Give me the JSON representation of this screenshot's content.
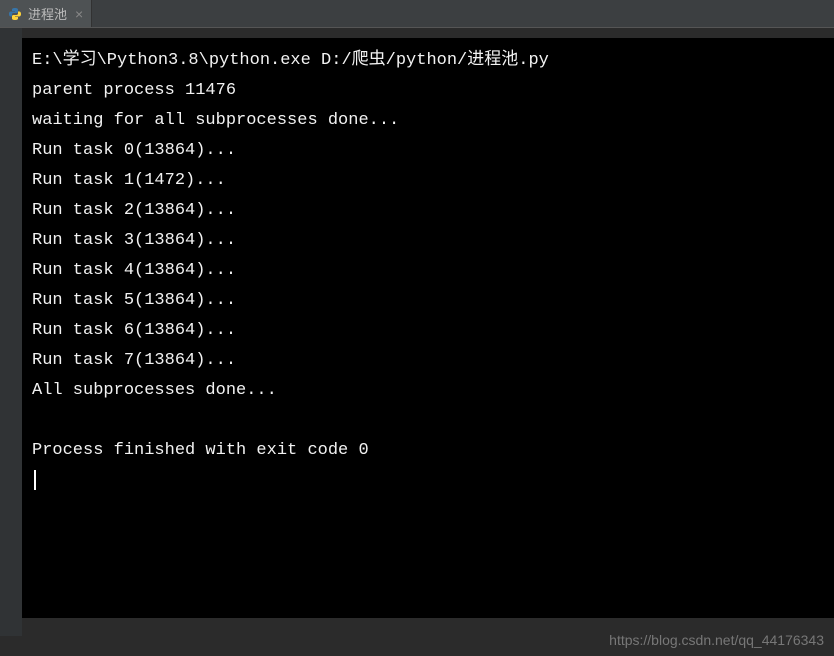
{
  "tab": {
    "label": "进程池",
    "close_symbol": "×"
  },
  "console": {
    "command": "E:\\学习\\Python3.8\\python.exe D:/爬虫/python/进程池.py",
    "lines": [
      "parent process 11476",
      "waiting for all subprocesses done...",
      "Run task 0(13864)...",
      "Run task 1(1472)...",
      "Run task 2(13864)...",
      "Run task 3(13864)...",
      "Run task 4(13864)...",
      "Run task 5(13864)...",
      "Run task 6(13864)...",
      "Run task 7(13864)...",
      "All subprocesses done..."
    ],
    "finish": "Process finished with exit code 0"
  },
  "watermark": "https://blog.csdn.net/qq_44176343"
}
